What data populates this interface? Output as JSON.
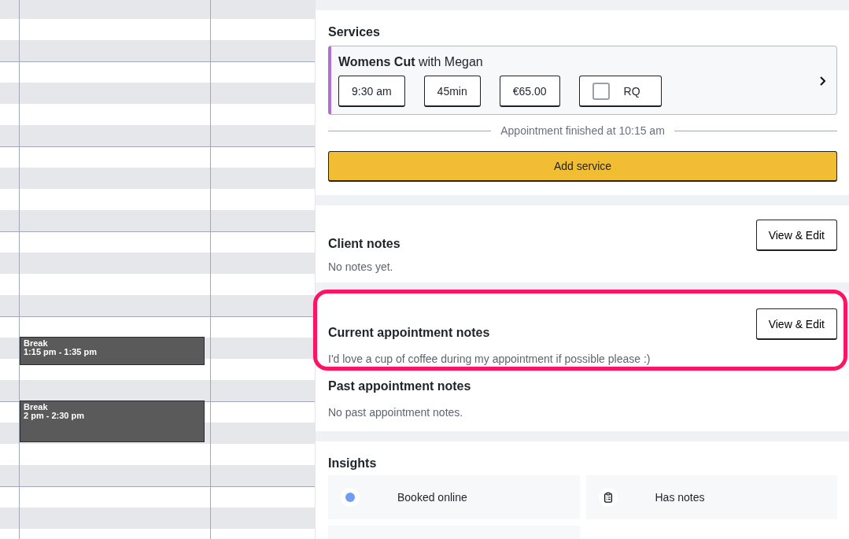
{
  "calendar": {
    "events": [
      {
        "title": "Break",
        "time": "1:15 pm - 1:35 pm"
      },
      {
        "title": "Break",
        "time": "2 pm - 2:30 pm"
      }
    ]
  },
  "services": {
    "heading": "Services",
    "service": {
      "name": "Womens Cut",
      "staff": "with Megan",
      "time": "9:30 am",
      "duration": "45min",
      "price": "€65.00",
      "request": {
        "label": "RQ",
        "checked": false
      }
    },
    "finished": "Appointment finished at 10:15 am",
    "add_button": "Add service"
  },
  "client_notes": {
    "heading": "Client notes",
    "button": "View & Edit",
    "text": "No notes yet."
  },
  "current_notes": {
    "heading": "Current appointment notes",
    "button": "View & Edit",
    "text": "I'd love a cup of coffee during my appointment if possible please :)",
    "highlighted": true
  },
  "past_notes": {
    "heading": "Past appointment notes",
    "text": "No past appointment notes."
  },
  "insights": {
    "heading": "Insights",
    "items": [
      {
        "kind": "online",
        "label": "Booked online"
      },
      {
        "kind": "notes",
        "label": "Has notes"
      },
      {
        "kind": "blank"
      }
    ]
  }
}
